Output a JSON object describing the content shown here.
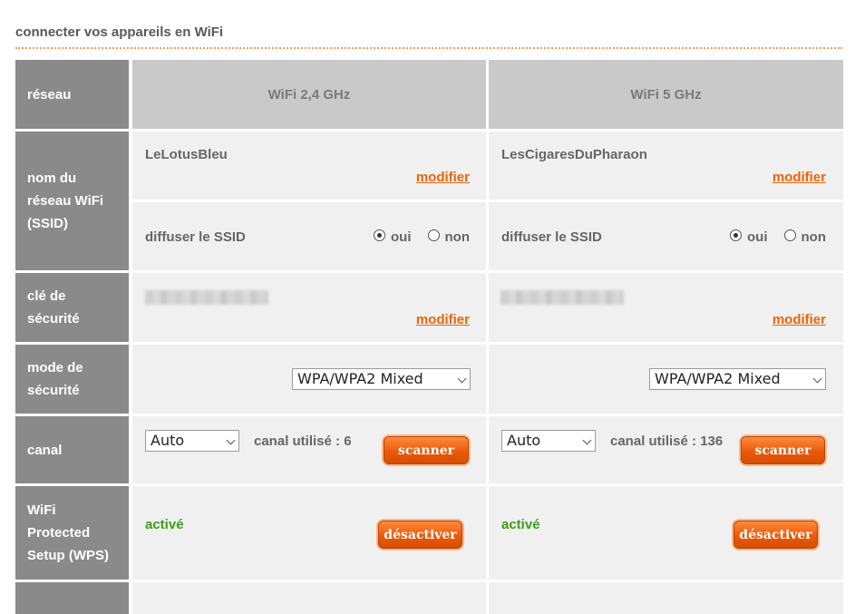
{
  "page": {
    "title": "connecter vos appareils en WiFi"
  },
  "row_headers": {
    "network": "réseau",
    "ssid": "nom du réseau WiFi (SSID)",
    "security_key": "clé de sécurité",
    "security_mode": "mode de sécurité",
    "channel": "canal",
    "wps": "WiFi Protected Setup (WPS)"
  },
  "columns": [
    {
      "header": "WiFi 2,4 GHz",
      "ssid_name": "LeLotusBleu",
      "modify_ssid_label": "modifier",
      "broadcast_label": "diffuser le SSID",
      "broadcast_yes": "oui",
      "broadcast_no": "non",
      "broadcast_selected": "oui",
      "modify_key_label": "modifier",
      "security_mode_value": "WPA/WPA2 Mixed",
      "channel_select_value": "Auto",
      "channel_used_text": "canal utilisé : 6",
      "scan_button": "scanner",
      "wps_status": "activé",
      "wps_button": "désactiver"
    },
    {
      "header": "WiFi 5 GHz",
      "ssid_name": "LesCigaresDuPharaon",
      "modify_ssid_label": "modifier",
      "broadcast_label": "diffuser le SSID",
      "broadcast_yes": "oui",
      "broadcast_no": "non",
      "broadcast_selected": "oui",
      "modify_key_label": "modifier",
      "security_mode_value": "WPA/WPA2 Mixed",
      "channel_select_value": "Auto",
      "channel_used_text": "canal utilisé : 136",
      "scan_button": "scanner",
      "wps_status": "activé",
      "wps_button": "désactiver"
    }
  ],
  "colors": {
    "accent": "#e8650a",
    "row_header_bg": "#8a8a8a",
    "column_header_bg": "#c9c9c9",
    "cell_bg": "#f0f0f0",
    "active_status": "#3d9b1a"
  }
}
